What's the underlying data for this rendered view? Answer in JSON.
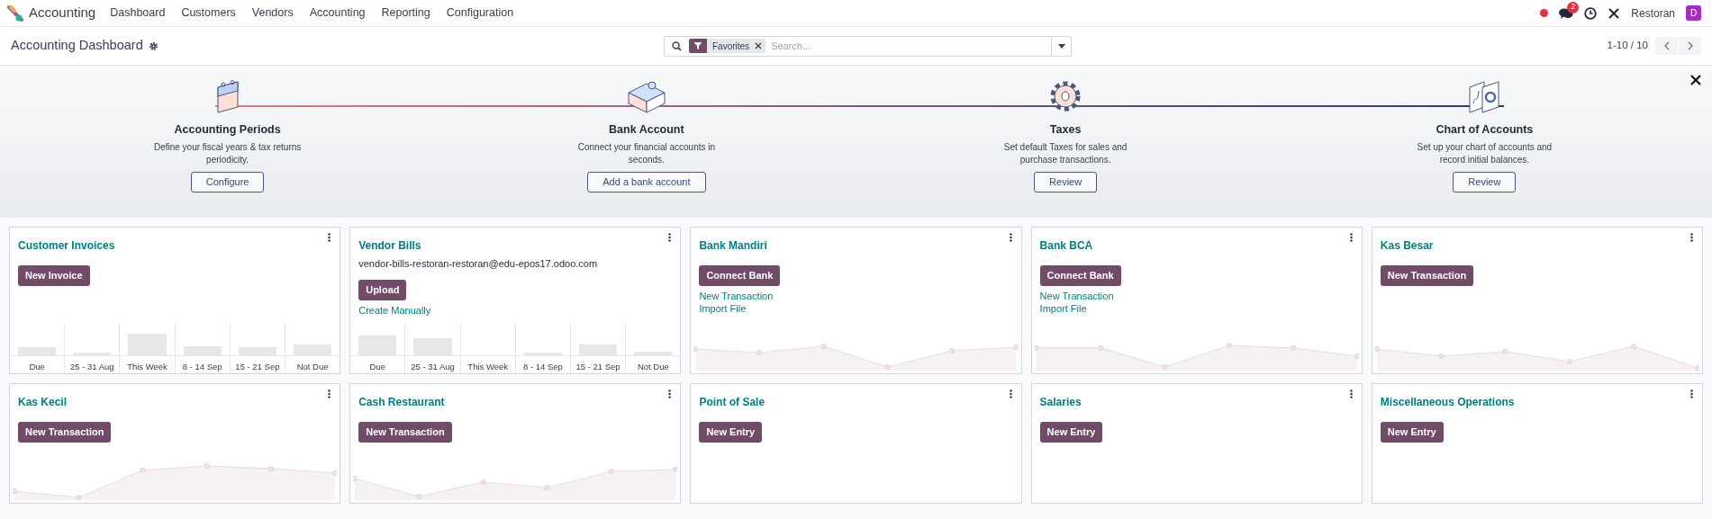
{
  "app": {
    "name": "Accounting"
  },
  "menu": [
    "Dashboard",
    "Customers",
    "Vendors",
    "Accounting",
    "Reporting",
    "Configuration"
  ],
  "systray": {
    "messages_count": "2",
    "company": "Restoran",
    "avatar": "D"
  },
  "breadcrumb": "Accounting Dashboard",
  "search": {
    "facet": "Favorites",
    "placeholder": "Search..."
  },
  "pager": {
    "value": "1-10 / 10"
  },
  "onboarding": [
    {
      "kind": "calendar",
      "title": "Accounting Periods",
      "text": "Define your fiscal years & tax returns periodicity.",
      "button": "Configure"
    },
    {
      "kind": "bank",
      "title": "Bank Account",
      "text": "Connect your financial accounts in seconds.",
      "button": "Add a bank account"
    },
    {
      "kind": "taxes",
      "title": "Taxes",
      "text": "Set default Taxes for sales and purchase transactions.",
      "button": "Review"
    },
    {
      "kind": "chart",
      "title": "Chart of Accounts",
      "text": "Set up your chart of accounts and record initial balances.",
      "button": "Review"
    }
  ],
  "journals": [
    {
      "title": "Customer Invoices",
      "buttons": [
        "New Invoice"
      ],
      "graph": {
        "kind": "bar",
        "labels": [
          "Due",
          "25 - 31 Aug",
          "This Week",
          "8 - 14 Sep",
          "15 - 21 Sep",
          "Not Due"
        ]
      }
    },
    {
      "title": "Vendor Bills",
      "subtitle": "vendor-bills-restoran-restoran@edu-epos17.odoo.com",
      "buttons": [
        "Upload"
      ],
      "links": [
        "Create Manually"
      ],
      "graph": {
        "kind": "bar",
        "labels": [
          "Due",
          "25 - 31 Aug",
          "This Week",
          "8 - 14 Sep",
          "15 - 21 Sep",
          "Not Due"
        ]
      }
    },
    {
      "title": "Bank Mandiri",
      "buttons": [
        "Connect Bank"
      ],
      "links": [
        "New Transaction",
        "Import File"
      ],
      "graph": {
        "kind": "line"
      }
    },
    {
      "title": "Bank BCA",
      "buttons": [
        "Connect Bank"
      ],
      "links": [
        "New Transaction",
        "Import File"
      ],
      "graph": {
        "kind": "line"
      }
    },
    {
      "title": "Kas Besar",
      "buttons": [
        "New Transaction"
      ],
      "graph": {
        "kind": "line"
      }
    },
    {
      "title": "Kas Kecil",
      "buttons": [
        "New Transaction"
      ],
      "graph": {
        "kind": "line"
      }
    },
    {
      "title": "Cash Restaurant",
      "buttons": [
        "New Transaction"
      ],
      "graph": {
        "kind": "line"
      }
    },
    {
      "title": "Point of Sale",
      "buttons": [
        "New Entry"
      ]
    },
    {
      "title": "Salaries",
      "buttons": [
        "New Entry"
      ]
    },
    {
      "title": "Miscellaneous Operations",
      "buttons": [
        "New Entry"
      ]
    }
  ]
}
